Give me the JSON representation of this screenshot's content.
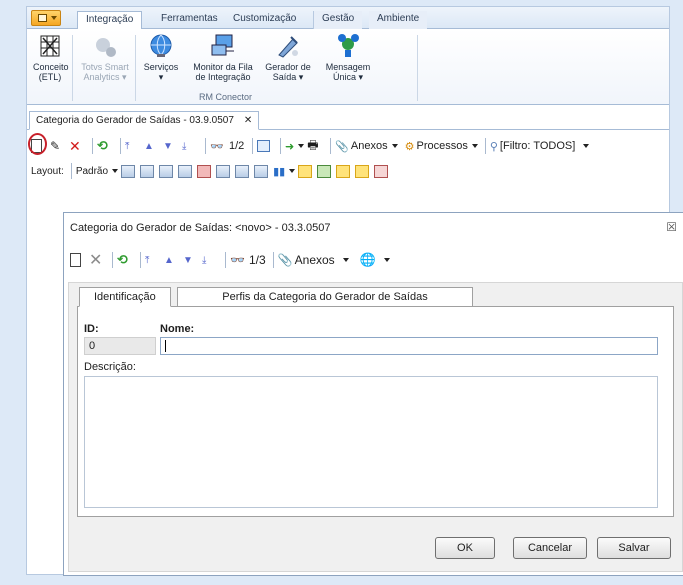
{
  "ribbon": {
    "tabs": [
      "Integração",
      "Ferramentas",
      "Customização",
      "Gestão",
      "Ambiente"
    ],
    "buttons": [
      {
        "line1": "Conceito",
        "line2": "(ETL)"
      },
      {
        "line1": "Totvs Smart",
        "line2": "Analytics ▾"
      },
      {
        "line1": "Serviços",
        "line2": "▾"
      },
      {
        "line1": "Monitor da Fila",
        "line2": "de Integração"
      },
      {
        "line1": "Gerador de",
        "line2": "Saída ▾"
      },
      {
        "line1": "Mensagem",
        "line2": "Única ▾"
      }
    ],
    "group_label": "RM Conector"
  },
  "document_tab": {
    "title": "Categoria do Gerador de Saídas - 03.9.0507",
    "close": "✕"
  },
  "toolbar1": {
    "page": "1/2",
    "anexos": "Anexos",
    "processos": "Processos",
    "filtro": "[Filtro: TODOS]"
  },
  "toolbar2": {
    "layout_label": "Layout:",
    "padrao": "Padrão"
  },
  "dialog": {
    "title": "Categoria do Gerador de Saídas: <novo> - 03.3.0507",
    "close": "☒",
    "page": "1/3",
    "anexos": "Anexos",
    "tabs": [
      "Identificação",
      "Perfis da Categoria do Gerador de Saídas"
    ],
    "id_label": "ID:",
    "id_value": "0",
    "nome_label": "Nome:",
    "nome_value": "",
    "descricao_label": "Descrição:",
    "descricao_value": "",
    "buttons": {
      "ok": "OK",
      "cancelar": "Cancelar",
      "salvar": "Salvar"
    }
  },
  "colors": {
    "background": "#dde9f7",
    "highlight": "#c8202a",
    "ribbon_accent": "#f5a623"
  }
}
